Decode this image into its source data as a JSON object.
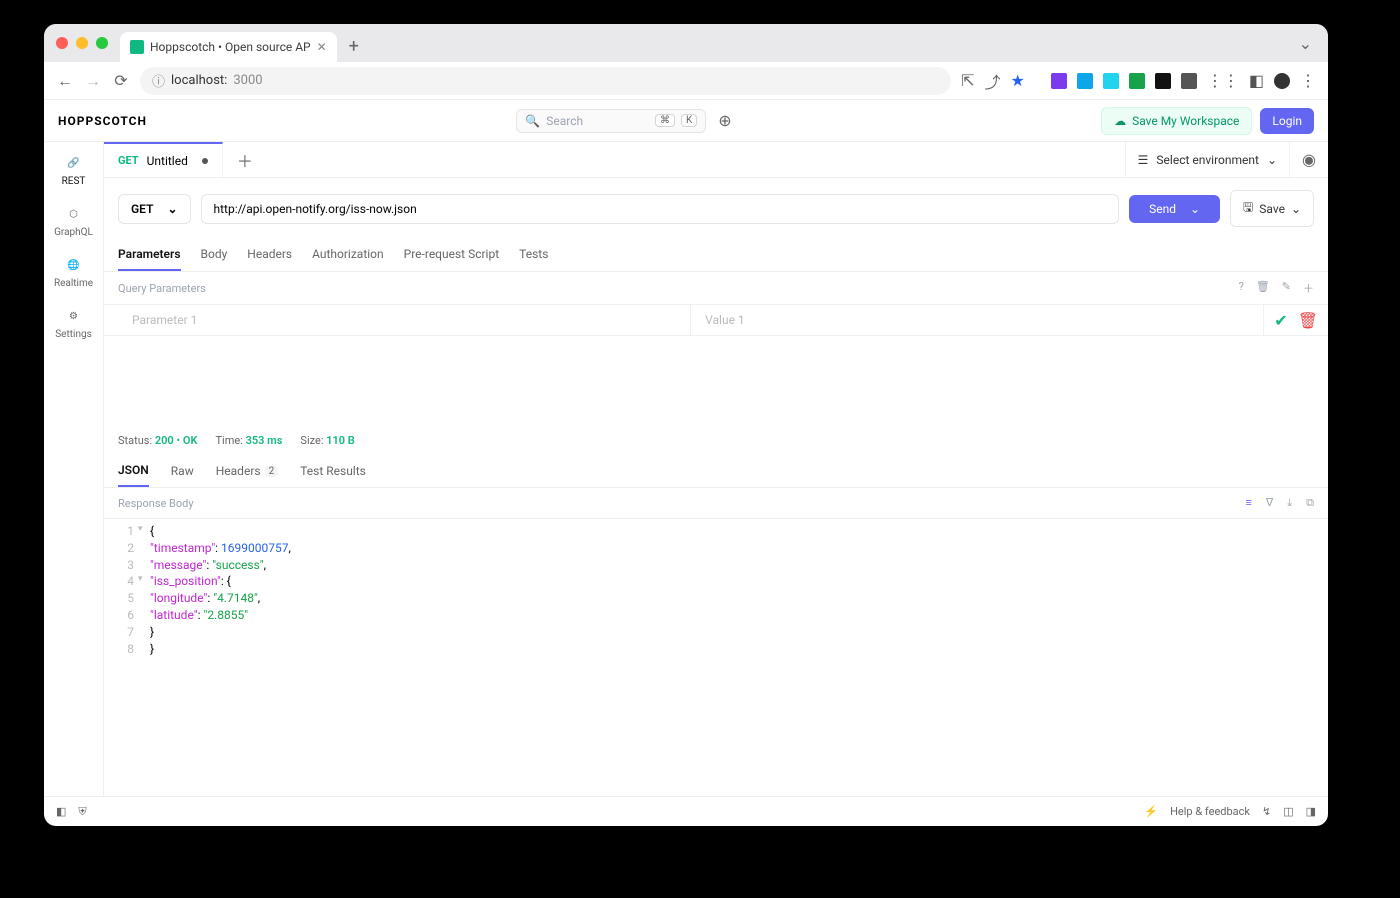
{
  "browser": {
    "tab_title": "Hoppscotch • Open source AP",
    "url_host": "localhost:",
    "url_port": "3000"
  },
  "app": {
    "logo": "HOPPSCOTCH",
    "search_placeholder": "Search",
    "kbd1": "⌘",
    "kbd2": "K",
    "save_workspace": "Save My Workspace",
    "login": "Login"
  },
  "sidebar": {
    "items": [
      {
        "label": "REST"
      },
      {
        "label": "GraphQL"
      },
      {
        "label": "Realtime"
      },
      {
        "label": "Settings"
      }
    ]
  },
  "tabs": {
    "get_label": "GET",
    "title": "Untitled",
    "env_label": "Select environment"
  },
  "request": {
    "method": "GET",
    "url": "http://api.open-notify.org/iss-now.json",
    "send": "Send",
    "save": "Save"
  },
  "subtabs": [
    "Parameters",
    "Body",
    "Headers",
    "Authorization",
    "Pre-request Script",
    "Tests"
  ],
  "params": {
    "section": "Query Parameters",
    "ph_key": "Parameter 1",
    "ph_val": "Value 1"
  },
  "status": {
    "status_lbl": "Status:",
    "code": "200",
    "ok": "OK",
    "time_lbl": "Time:",
    "time": "353 ms",
    "size_lbl": "Size:",
    "size": "110 B"
  },
  "resp_tabs": {
    "json": "JSON",
    "raw": "Raw",
    "headers": "Headers",
    "headers_count": "2",
    "tests": "Test Results"
  },
  "resp_section": "Response Body",
  "response_json": {
    "timestamp": 1699000757,
    "message": "success",
    "iss_position": {
      "longitude": "4.7148",
      "latitude": "2.8855"
    }
  },
  "footer": {
    "help": "Help & feedback"
  }
}
